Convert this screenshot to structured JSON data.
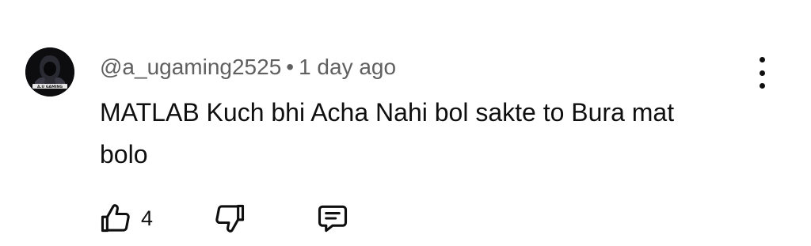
{
  "comment": {
    "author": "@a_ugaming2525",
    "separator": "•",
    "time": "1 day ago",
    "text": "MATLAB Kuch bhi Acha Nahi bol sakte to Bura mat bolo",
    "avatar_caption": "A.U GAMING"
  },
  "actions": {
    "like_icon": "thumbs-up-icon",
    "like_count": "4",
    "dislike_icon": "thumbs-down-icon",
    "reply_icon": "comment-icon"
  },
  "menu": {
    "icon": "vertical-dots-icon"
  },
  "colors": {
    "meta_text": "#606060",
    "body_text": "#0f0f0f",
    "background": "#ffffff"
  }
}
